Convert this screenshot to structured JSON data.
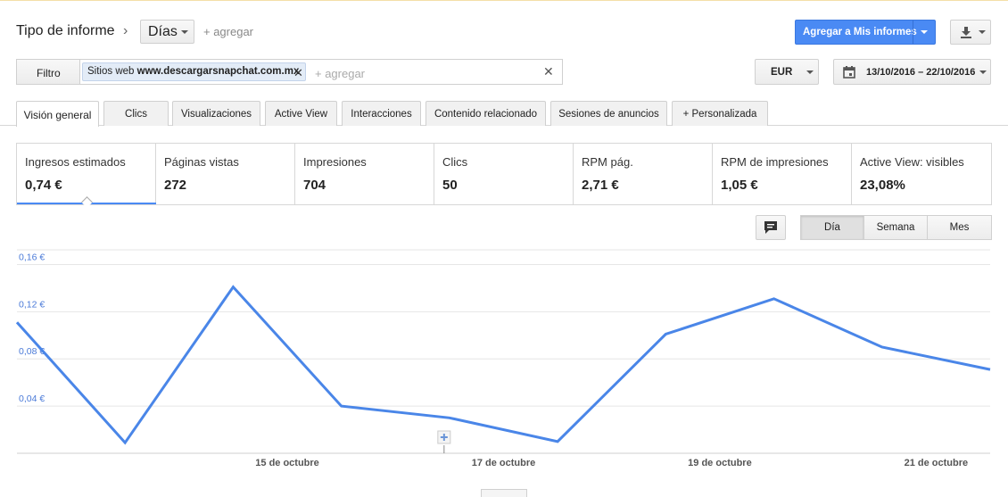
{
  "header": {
    "report_type_label": "Tipo de informe",
    "separator": "›",
    "granularity": "Días",
    "add_link": "+ agregar",
    "add_to_reports": "Agregar a Mis informes"
  },
  "filter": {
    "label": "Filtro",
    "chip_prefix": "Sitios web",
    "chip_value": "www.descargarsnapchat.com.mx",
    "placeholder": "+ agregar",
    "currency": "EUR",
    "date_range": "13/10/2016 – 22/10/2016"
  },
  "tabs": [
    {
      "label": "Visión general",
      "active": true
    },
    {
      "label": "Clics"
    },
    {
      "label": "Visualizaciones"
    },
    {
      "label": "Active View"
    },
    {
      "label": "Interacciones"
    },
    {
      "label": "Contenido relacionado"
    },
    {
      "label": "Sesiones de anuncios"
    },
    {
      "label": "+ Personalizada"
    }
  ],
  "metrics": [
    {
      "name": "Ingresos estimados",
      "value": "0,74 €"
    },
    {
      "name": "Páginas vistas",
      "value": "272"
    },
    {
      "name": "Impresiones",
      "value": "704"
    },
    {
      "name": "Clics",
      "value": "50"
    },
    {
      "name": "RPM pág.",
      "value": "2,71 €"
    },
    {
      "name": "RPM de impresiones",
      "value": "1,05 €"
    },
    {
      "name": "Active View: visibles",
      "value": "23,08%"
    }
  ],
  "period_toggle": {
    "day": "Día",
    "week": "Semana",
    "month": "Mes",
    "selected": "Día"
  },
  "colors": {
    "accent": "#4a8af4",
    "line": "#4a86e8",
    "grid": "#e6e6e6"
  },
  "icons": [
    "chevron-right-icon",
    "download-icon",
    "close-icon",
    "calendar-icon",
    "comment-icon",
    "plus-icon"
  ],
  "chart_data": {
    "type": "line",
    "x": [
      "13/10",
      "14/10",
      "15/10",
      "16/10",
      "17/10",
      "18/10",
      "19/10",
      "20/10",
      "21/10",
      "22/10"
    ],
    "series": [
      {
        "values": [
          0.111,
          0.009,
          0.141,
          0.04,
          0.03,
          0.01,
          0.101,
          0.131,
          0.09,
          0.071
        ]
      }
    ],
    "ylim": [
      0,
      0.18
    ],
    "y_ticks": [
      0.04,
      0.08,
      0.12,
      0.16
    ],
    "y_tick_labels": [
      "0,04 €",
      "0,08 €",
      "0,12 €",
      "0,16 €"
    ],
    "x_tick_labels": [
      {
        "index": 2,
        "label": "15 de octubre"
      },
      {
        "index": 4,
        "label": "17 de octubre"
      },
      {
        "index": 6,
        "label": "19 de octubre"
      },
      {
        "index": 8,
        "label": "21 de octubre"
      }
    ],
    "grid": true
  }
}
